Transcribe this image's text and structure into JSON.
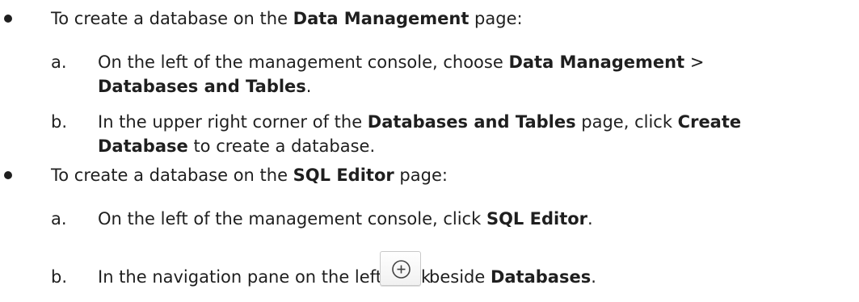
{
  "sections": [
    {
      "intro": {
        "pre": "To create a database on the ",
        "bold": "Data Management",
        "post": " page:"
      },
      "steps": [
        {
          "marker": "a.",
          "line1": {
            "pre": "On the left of the management console, choose ",
            "bold": "Data Management",
            "post": " >"
          },
          "line2": {
            "bold": "Databases and Tables",
            "post": "."
          }
        },
        {
          "marker": "b.",
          "line1": {
            "pre": "In the upper right corner of the ",
            "bold1": "Databases and Tables",
            "mid": " page, click ",
            "bold2": "Create"
          },
          "line2": {
            "bold": "Database",
            "post": " to create a database."
          }
        }
      ]
    },
    {
      "intro": {
        "pre": "To create a database on the ",
        "bold": "SQL Editor",
        "post": " page:"
      },
      "steps": [
        {
          "marker": "a.",
          "line1": {
            "pre": "On the left of the management console, click ",
            "bold": "SQL Editor",
            "post": "."
          }
        },
        {
          "marker": "b.",
          "line1": {
            "pre": "In the navigation pane on the left, click ",
            "icon": "add-circle-icon",
            "mid": " beside ",
            "bold": "Databases",
            "post": "."
          }
        }
      ]
    }
  ]
}
